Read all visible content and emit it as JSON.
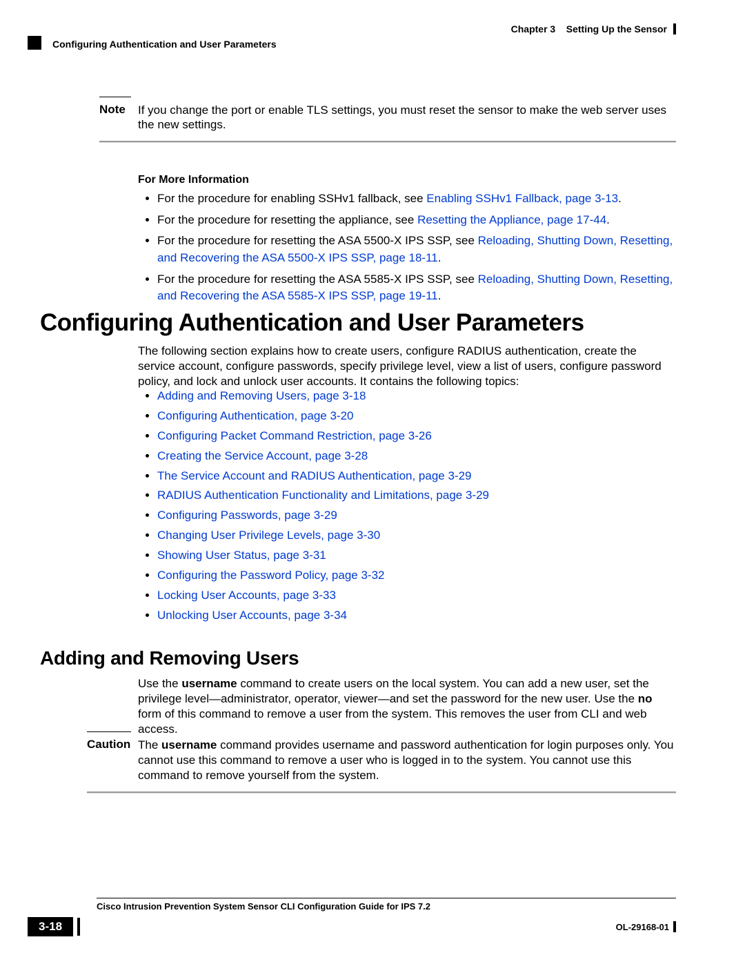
{
  "header": {
    "chapter_label": "Chapter 3",
    "chapter_title": "Setting Up the Sensor",
    "section_title": "Configuring Authentication and User Parameters"
  },
  "note": {
    "label": "Note",
    "text": "If you change the port or enable TLS settings, you must reset the sensor to make the web server uses the new settings."
  },
  "for_more_info": {
    "heading": "For More Information",
    "items": [
      {
        "pre": "For the procedure for enabling SSHv1 fallback, see ",
        "link": "Enabling SSHv1 Fallback, page 3-13",
        "post": "."
      },
      {
        "pre": "For the procedure for resetting the appliance, see ",
        "link": "Resetting the Appliance, page 17-44",
        "post": "."
      },
      {
        "pre": "For the procedure for resetting the ASA 5500-X IPS SSP, see ",
        "link": "Reloading, Shutting Down, Resetting, and Recovering the ASA 5500-X IPS SSP, page 18-11",
        "post": "."
      },
      {
        "pre": "For the procedure for resetting the ASA 5585-X IPS SSP, see ",
        "link": "Reloading, Shutting Down, Resetting, and Recovering the ASA 5585-X IPS SSP, page 19-11",
        "post": "."
      }
    ]
  },
  "h1": "Configuring Authentication and User Parameters",
  "intro": "The following section explains how to create users, configure RADIUS authentication, create the service account, configure passwords, specify privilege level, view a list of users, configure password policy, and lock and unlock user accounts. It contains the following topics:",
  "topics": [
    "Adding and Removing Users, page 3-18",
    "Configuring Authentication, page 3-20",
    "Configuring Packet Command Restriction, page 3-26",
    "Creating the Service Account, page 3-28",
    "The Service Account and RADIUS Authentication, page 3-29",
    "RADIUS Authentication Functionality and Limitations, page 3-29",
    "Configuring Passwords, page 3-29",
    "Changing User Privilege Levels, page 3-30",
    "Showing User Status, page 3-31",
    "Configuring the Password Policy, page 3-32",
    "Locking User Accounts, page 3-33",
    "Unlocking User Accounts, page 3-34"
  ],
  "h2": "Adding and Removing Users",
  "adding_para": {
    "t1": "Use the ",
    "b1": "username",
    "t2": " command to create users on the local system. You can add a new user, set the privilege level—administrator, operator, viewer—and set the password for the new user. Use the ",
    "b2": "no",
    "t3": " form of this command to remove a user from the system. This removes the user from CLI and web access."
  },
  "caution": {
    "label": "Caution",
    "t1": "The ",
    "b1": "username",
    "t2": " command provides username and password authentication for login purposes only. You cannot use this command to remove a user who is logged in to the system. You cannot use this command to remove yourself from the system."
  },
  "footer": {
    "guide": "Cisco Intrusion Prevention System Sensor CLI Configuration Guide for IPS 7.2",
    "page": "3-18",
    "docid": "OL-29168-01"
  }
}
